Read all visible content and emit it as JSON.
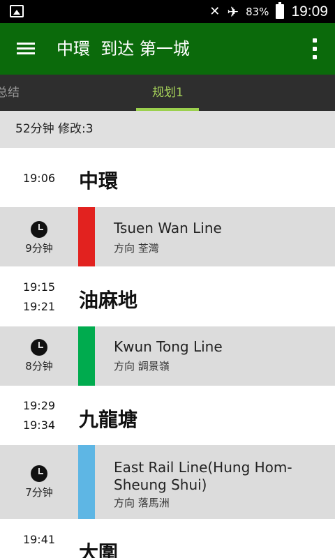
{
  "status_bar": {
    "battery_percent": "83%",
    "time": "19:09",
    "icons": [
      "image-icon",
      "mute-icon",
      "airplane-icon",
      "battery-icon"
    ]
  },
  "toolbar": {
    "title": "中環  到达 第一城",
    "menu_icon": "hamburger-menu-icon",
    "overflow_icon": "overflow-menu-icon"
  },
  "tabs": [
    {
      "label": "总结",
      "selected": false
    },
    {
      "label": "规划1",
      "selected": true
    }
  ],
  "summary": {
    "text": "52分钟  修改:3"
  },
  "colors": {
    "toolbar": "#0b6a0b",
    "tab_indicator": "#9bd04e",
    "tsuen_wan_line": "#e2221f",
    "kwun_tong_line": "#00ab4e",
    "east_rail_line": "#5eb6e4"
  },
  "route": {
    "stop1": {
      "times": [
        "19:06"
      ],
      "name": "中環"
    },
    "seg1": {
      "duration": "9分钟",
      "line": "Tsuen Wan Line",
      "line2": "",
      "direction": "方向 荃灣",
      "color": "#e2221f"
    },
    "stop2": {
      "times": [
        "19:15",
        "19:21"
      ],
      "name": "油麻地"
    },
    "seg2": {
      "duration": "8分钟",
      "line": "Kwun Tong Line",
      "line2": "",
      "direction": "方向 調景嶺",
      "color": "#00ab4e"
    },
    "stop3": {
      "times": [
        "19:29",
        "19:34"
      ],
      "name": "九龍塘"
    },
    "seg3": {
      "duration": "7分钟",
      "line": "East Rail Line(Hung Hom-",
      "line2": "Sheung Shui)",
      "direction": "方向 落馬洲",
      "color": "#5eb6e4"
    },
    "stop4": {
      "times": [
        "19:41"
      ],
      "name": "大圍"
    }
  }
}
